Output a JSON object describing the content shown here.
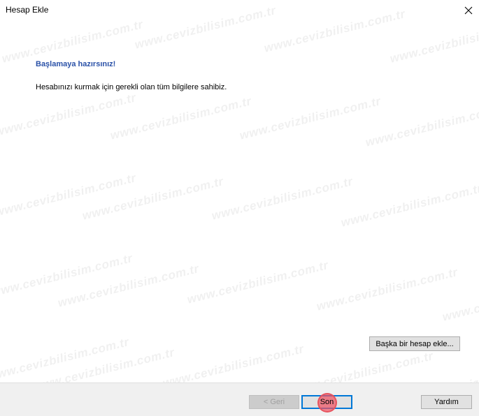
{
  "window": {
    "title": "Hesap Ekle"
  },
  "content": {
    "heading": "Başlamaya hazırsınız!",
    "message": "Hesabınızı kurmak için gerekli olan tüm bilgilere sahibiz.",
    "add_another_label": "Başka bir hesap ekle..."
  },
  "footer": {
    "back_label": "< Geri",
    "finish_label": "Son",
    "help_label": "Yardım"
  },
  "watermark": {
    "text": "www.cevizbilisim.com.tr"
  },
  "colors": {
    "heading": "#2b52a8",
    "focus_border": "#0078d7",
    "footer_bg": "#f0f0f0"
  }
}
